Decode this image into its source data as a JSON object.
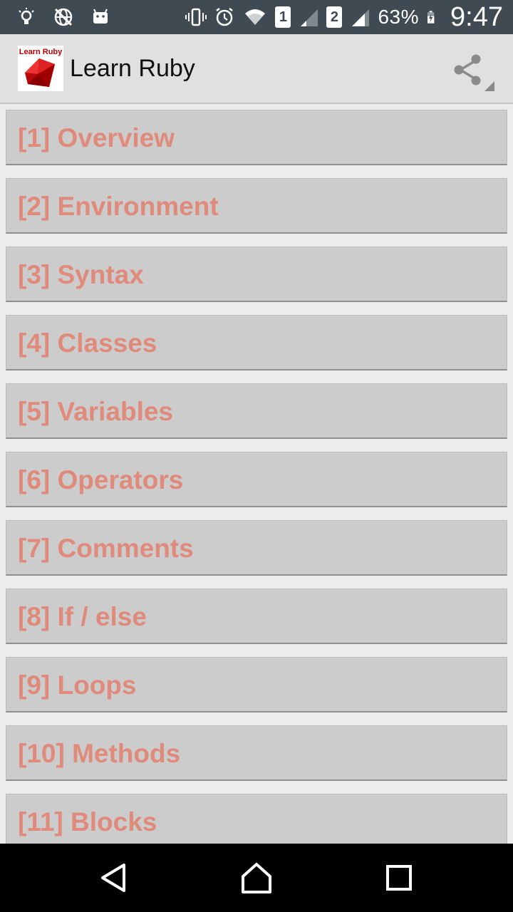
{
  "status_bar": {
    "left_icons": [
      "bulb-icon",
      "globe-off-icon",
      "android-icon"
    ],
    "sim1_label": "1",
    "sim2_label": "2",
    "battery_percent": "63%",
    "time": "9:47"
  },
  "app_bar": {
    "logo_text": "Learn Ruby",
    "title": "Learn Ruby",
    "share_icon": "share-icon"
  },
  "lessons": [
    {
      "label": "[1] Overview"
    },
    {
      "label": "[2] Environment"
    },
    {
      "label": "[3] Syntax"
    },
    {
      "label": "[4] Classes"
    },
    {
      "label": "[5] Variables"
    },
    {
      "label": "[6] Operators"
    },
    {
      "label": "[7] Comments"
    },
    {
      "label": "[8] If / else"
    },
    {
      "label": "[9] Loops"
    },
    {
      "label": "[10] Methods"
    },
    {
      "label": "[11] Blocks"
    }
  ],
  "nav_bar": {
    "back_icon": "back-triangle-icon",
    "home_icon": "home-icon",
    "recents_icon": "recents-square-icon"
  },
  "colors": {
    "item_text": "#e08a7c",
    "item_bg": "#cccccc",
    "appbar_bg": "#e0e0e0",
    "statusbar_bg": "#3f4a52"
  }
}
